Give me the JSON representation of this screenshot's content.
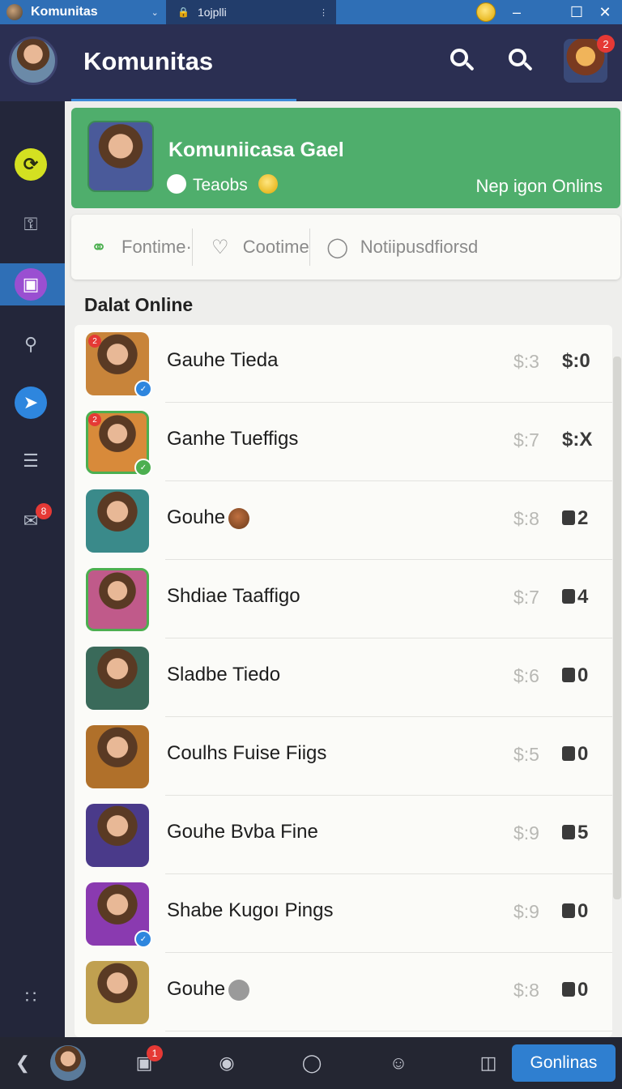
{
  "titlebar": {
    "app_name": "Komunitas",
    "tab_label": "1ojplli",
    "icons": [
      "app-logo-icon",
      "chevron-down-icon",
      "lock-icon",
      "tab-menu-icon",
      "coin-icon",
      "minimize-icon",
      "maximize-icon",
      "close-icon"
    ]
  },
  "header": {
    "title": "Komunitas",
    "notification_count": "2"
  },
  "rail": {
    "items": [
      "sync-icon",
      "key-icon",
      "bag-icon",
      "search-icon",
      "send-icon",
      "list-icon",
      "mail-icon",
      "dots-icon"
    ],
    "mail_badge": "8"
  },
  "banner": {
    "title": "Komuniicasa Gael",
    "subtitle": "Teaobs",
    "right_text": "Nep igon Onlins"
  },
  "tabs": [
    {
      "label": "Fontime·",
      "icon": "link-icon"
    },
    {
      "label": "Cootime",
      "icon": "shield-icon"
    },
    {
      "label": "Notiipusdfiorsd",
      "icon": "notification-icon"
    }
  ],
  "section_title": "Dalat Online",
  "list": [
    {
      "name": "Gauhe Tieda",
      "price": "$:3",
      "value": "$:0",
      "badge": "2",
      "green": false,
      "check": "#2e86de",
      "bg": "#c8843a"
    },
    {
      "name": "Ganhe Tueffigs",
      "price": "$:7",
      "value": "$:X",
      "badge": "2",
      "green": true,
      "check": "#4caf50",
      "bg": "#d88a3a"
    },
    {
      "name": "Gouhe",
      "price": "$:8",
      "value": "2",
      "badge": "",
      "green": false,
      "check": "",
      "bg": "#3a8a8a"
    },
    {
      "name": "Shdiae Taaffigo",
      "price": "$:7",
      "value": "4",
      "badge": "",
      "green": true,
      "check": "",
      "bg": "#c05a8a"
    },
    {
      "name": "Sladbe Tiedo",
      "price": "$:6",
      "value": "0",
      "badge": "",
      "green": false,
      "check": "",
      "bg": "#3a6a5a"
    },
    {
      "name": "Coulhs Fuise Fiigs",
      "price": "$:5",
      "value": "0",
      "badge": "",
      "green": false,
      "check": "",
      "bg": "#b0702a"
    },
    {
      "name": "Gouhe Bvba Fine",
      "price": "$:9",
      "value": "5",
      "badge": "",
      "green": false,
      "check": "",
      "bg": "#4a3a8a"
    },
    {
      "name": "Shabe Kugoı Pings",
      "price": "$:9",
      "value": "0",
      "badge": "",
      "green": false,
      "check": "#2e86de",
      "bg": "#8a3ab0"
    },
    {
      "name": "Gouhe",
      "price": "$:8",
      "value": "0",
      "badge": "",
      "green": false,
      "check": "",
      "bg": "#c0a050"
    }
  ],
  "bottombar": {
    "notif_badge": "1",
    "cta": "Gonlinas",
    "icons": [
      "back-icon",
      "avatar",
      "gift-icon",
      "game-icon",
      "circle-icon",
      "person-icon",
      "window-icon"
    ]
  },
  "colors": {
    "titlebar": "#2f6fb6",
    "header": "#2b2f52",
    "banner": "#4fae6c",
    "badge": "#e53935",
    "cta": "#2f7fd0"
  }
}
